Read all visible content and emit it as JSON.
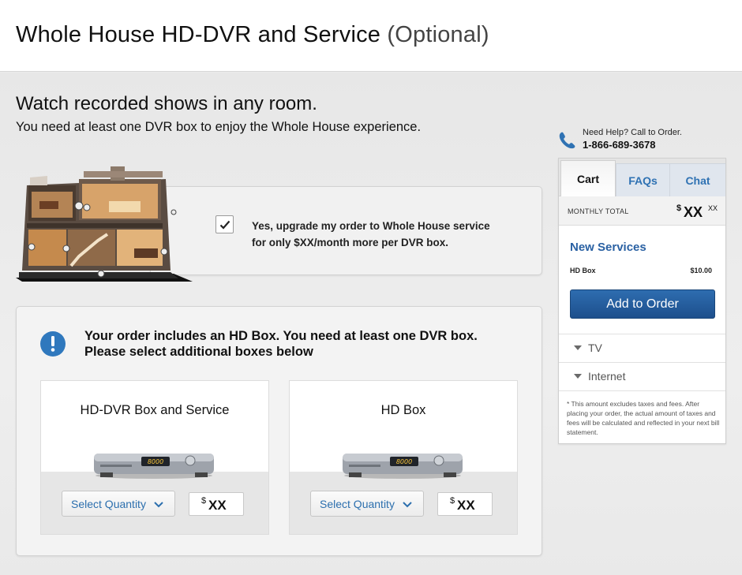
{
  "page": {
    "title": "Whole House HD-DVR and Service",
    "title_suffix": "(Optional)"
  },
  "intro": {
    "headline": "Watch recorded shows in any room.",
    "subline": "You need at least one DVR box to enjoy the Whole House experience."
  },
  "upgrade": {
    "checked": true,
    "line1": "Yes, upgrade my order to Whole House service",
    "line2": "for only $XX/month more per DVR box."
  },
  "order_notice": {
    "line1": "Your order includes an HD Box. You need at least one DVR box.",
    "line2": "Please select additional boxes below"
  },
  "products": [
    {
      "name": "HD-DVR Box and Service",
      "select_label": "Select Quantity",
      "currency": "$",
      "price": "XX",
      "display_text": "8000"
    },
    {
      "name": "HD Box",
      "select_label": "Select Quantity",
      "currency": "$",
      "price": "XX",
      "display_text": "8000"
    }
  ],
  "help": {
    "label": "Need Help? Call to Order.",
    "phone": "1-866-689-3678"
  },
  "cart": {
    "tabs": [
      "Cart",
      "FAQs",
      "Chat"
    ],
    "active_tab": "Cart",
    "monthly_total_label": "MONTHLY TOTAL",
    "currency": "$",
    "total": "XX",
    "total_cents": "XX",
    "section_title": "New Services",
    "items": [
      {
        "name": "HD Box",
        "price": "$10.00"
      }
    ],
    "add_button": "Add to Order",
    "accordions": [
      "TV",
      "Internet"
    ],
    "disclaimer": "* This amount excludes taxes and fees. After placing your order, the actual amount of taxes and fees will be calculated and reflected in your next bill statement."
  },
  "colors": {
    "accent_blue": "#2f78bd",
    "button_blue": "#1d4f8c",
    "link_blue": "#2c6fae"
  }
}
